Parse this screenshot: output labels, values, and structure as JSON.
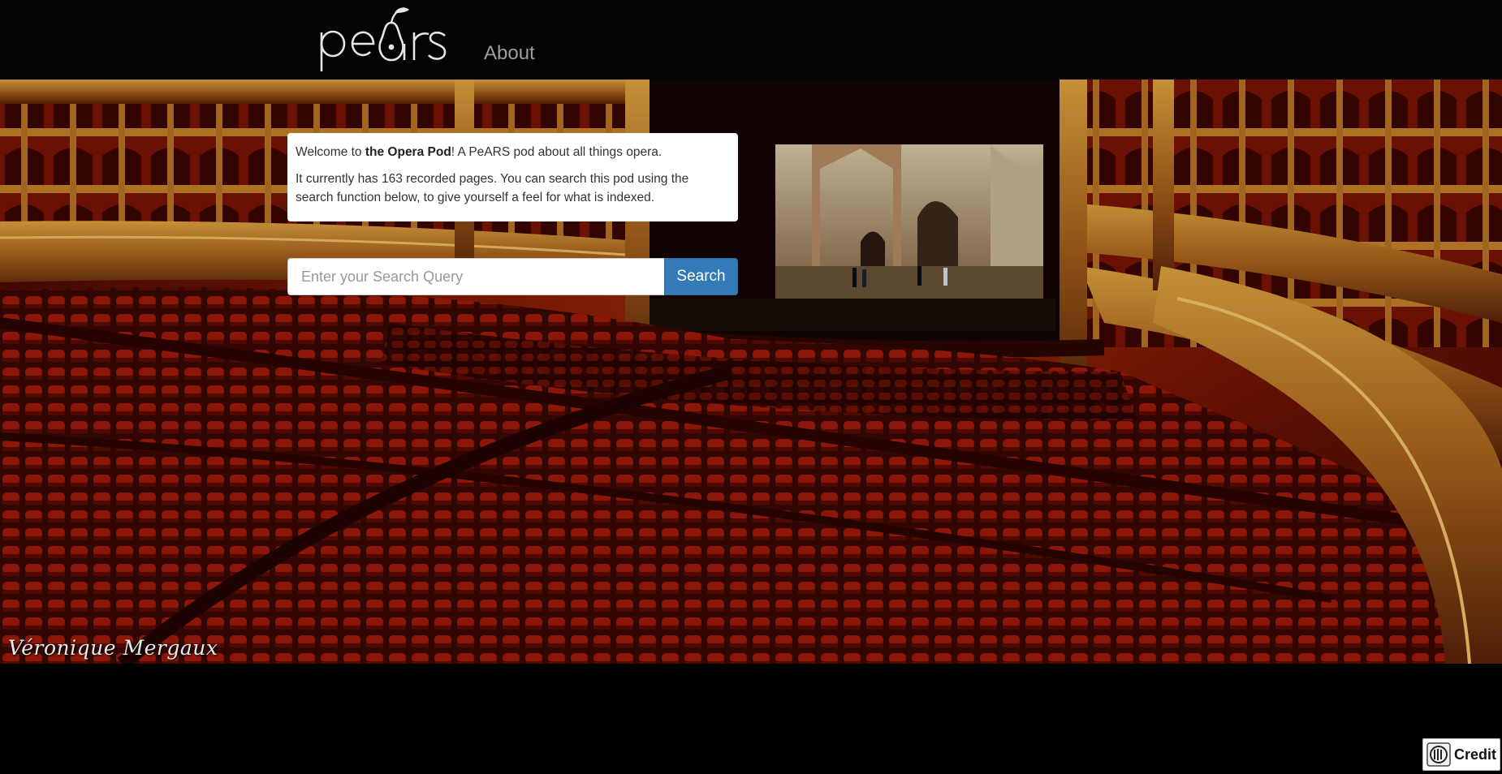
{
  "navbar": {
    "brand_text": "pears",
    "about_label": "About"
  },
  "hero": {
    "photographer_signature": "Véronique Mergaux"
  },
  "intro": {
    "welcome_prefix": "Welcome to ",
    "pod_name": "the Opera Pod",
    "welcome_suffix": "! A PeARS pod about all things opera.",
    "description": "It currently has 163 recorded pages. You can search this pod using the search function below, to give yourself a feel for what is indexed."
  },
  "search": {
    "placeholder": "Enter your Search Query",
    "value": "",
    "button_label": "Search"
  },
  "credit": {
    "label": "Credit",
    "icon": "credit-badge-icon"
  },
  "colors": {
    "navbar_bg": "#040404",
    "page_bg": "#000000",
    "accent": "#337ab7",
    "nav_link": "#9d9d9d",
    "theatre_red": "#8a1404",
    "theatre_gold": "#c48a2a"
  }
}
